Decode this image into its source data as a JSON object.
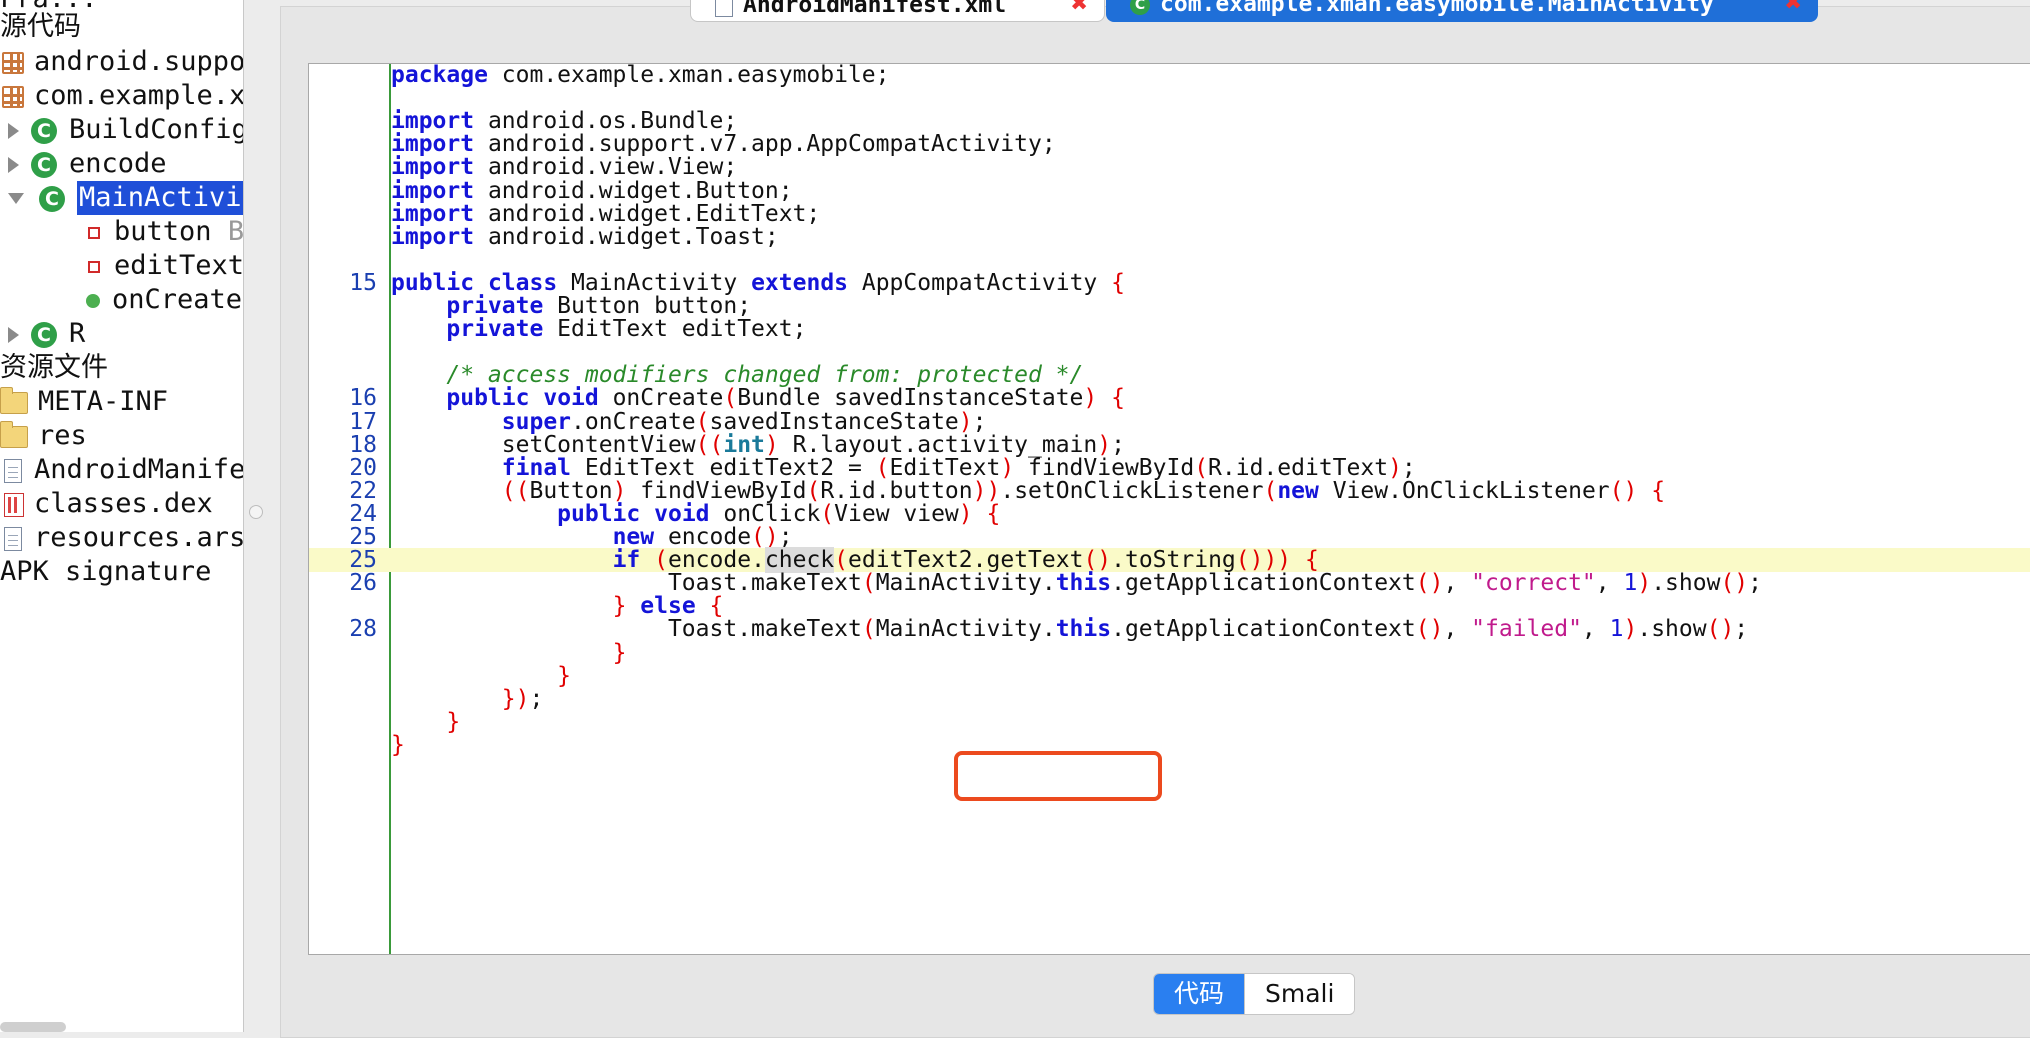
{
  "sidebar": {
    "top_clipped": "Fra...",
    "source_header": "源代码",
    "packages": [
      {
        "label": "android.suppo"
      },
      {
        "label": "com.example.x"
      }
    ],
    "classes": [
      {
        "label": "BuildConfig"
      },
      {
        "label": "encode"
      },
      {
        "label": "MainActivity"
      }
    ],
    "members": [
      {
        "label": "button",
        "suffix": "B"
      },
      {
        "label": "editText"
      },
      {
        "label": "onCreate"
      }
    ],
    "class_r": "R",
    "resources_header": "资源文件",
    "resources": [
      {
        "label": "META-INF"
      },
      {
        "label": "res"
      },
      {
        "label": "AndroidManifest"
      },
      {
        "label": "classes.dex"
      },
      {
        "label": "resources.arsc"
      }
    ],
    "apk_signature": "APK signature"
  },
  "tabs": {
    "manifest": "AndroidManifest.xml",
    "main": "com.example.xman.easymobile.MainActivity",
    "close_glyph": "✖"
  },
  "code": {
    "lines": [
      {
        "ln": "",
        "html_key": 0
      },
      {
        "ln": "",
        "html_key": 1
      },
      {
        "ln": "",
        "html_key": 2
      },
      {
        "ln": "",
        "html_key": 3
      },
      {
        "ln": "",
        "html_key": 4
      },
      {
        "ln": "",
        "html_key": 5
      },
      {
        "ln": "",
        "html_key": 6
      },
      {
        "ln": "",
        "html_key": 7
      },
      {
        "ln": "",
        "html_key": 8
      },
      {
        "ln": "15",
        "html_key": 9
      },
      {
        "ln": "",
        "html_key": 10
      },
      {
        "ln": "",
        "html_key": 11
      },
      {
        "ln": "",
        "html_key": 12
      },
      {
        "ln": "",
        "html_key": 13
      },
      {
        "ln": "16",
        "html_key": 14
      },
      {
        "ln": "17",
        "html_key": 15
      },
      {
        "ln": "18",
        "html_key": 16
      },
      {
        "ln": "20",
        "html_key": 17
      },
      {
        "ln": "22",
        "html_key": 18
      },
      {
        "ln": "24",
        "html_key": 19
      },
      {
        "ln": "25",
        "html_key": 20
      },
      {
        "ln": "25",
        "html_key": 21
      },
      {
        "ln": "26",
        "html_key": 22
      },
      {
        "ln": "",
        "html_key": 23
      },
      {
        "ln": "28",
        "html_key": 24
      },
      {
        "ln": "",
        "html_key": 25
      },
      {
        "ln": "",
        "html_key": 26
      },
      {
        "ln": "",
        "html_key": 27
      },
      {
        "ln": "",
        "html_key": 28
      },
      {
        "ln": "",
        "html_key": 29
      }
    ],
    "tokens": {
      "package": "package",
      "pkg_name": " com.example.xman.easymobile;",
      "import": "import",
      "imp1": " android.os.Bundle;",
      "imp2": " android.support.v7.app.AppCompatActivity;",
      "imp3": " android.view.View;",
      "imp4": " android.widget.Button;",
      "imp5": " android.widget.EditText;",
      "imp6": " android.widget.Toast;",
      "public": "public",
      "class": "class",
      "cls_name": " MainActivity ",
      "extends": "extends",
      "super_cls": " AppCompatActivity ",
      "lbrace": "{",
      "rbrace": "}",
      "private": "private",
      "f1": " Button button;",
      "f2": " EditText editText;",
      "comment": "/* access modifiers changed from: protected */",
      "void": "void",
      "oncreate_sig": " onCreate",
      "bundle_arg": "Bundle savedInstanceState",
      "super": "super",
      "super_call": ".onCreate",
      "sis": "savedInstanceState",
      "semi": ";",
      "setcv": "setContentView",
      "int": "int",
      "layout": " R.layout.activity_main",
      "final": "final",
      "et2_decl": " EditText editText2 = ",
      "et_cast": "EditText",
      "fvbi": " findViewById",
      "rid_et": "R.id.editText",
      "btn_cast": "Button",
      "fvbi2": " findViewById",
      "rid_btn": "R.id.button",
      "soncl": ".setOnClickListener",
      "new": "new",
      "view_ocl": " View.OnClickListener",
      "onclick": " onClick",
      "view_arg": "View view",
      "encode_new": " encode",
      "if": "if",
      "encode": "encode.",
      "check": "check",
      "gettext": "editText2.getText",
      "tostring": ".toString",
      "toast": "Toast.makeText",
      "ma": "MainActivity.",
      "this": "this",
      "gac": ".getApplicationContext",
      "correct": "\"correct\"",
      "failed": "\"failed\"",
      "one": "1",
      "show": ".show",
      "comma": ", ",
      "else": "else"
    }
  },
  "bottom_tabs": {
    "code": "代码",
    "smali": "Smali"
  }
}
